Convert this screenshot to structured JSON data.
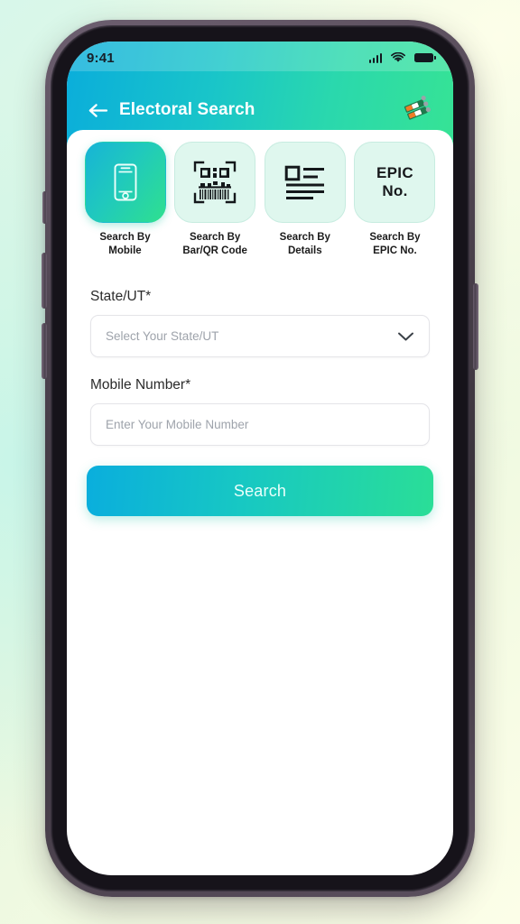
{
  "status_bar": {
    "time": "9:41",
    "signal_icon": "cellular-signal-icon",
    "wifi_icon": "wifi-icon",
    "battery_icon": "battery-full-icon"
  },
  "header": {
    "back_icon": "back-arrow-icon",
    "title": "Electoral Search",
    "logo_icon": "eci-evm-logo-icon"
  },
  "tabs": [
    {
      "icon": "mobile-phone-icon",
      "label_line1": "Search By",
      "label_line2": "Mobile",
      "active": true
    },
    {
      "icon": "barcode-qr-icon",
      "label_line1": "Search By",
      "label_line2": "Bar/QR Code",
      "active": false
    },
    {
      "icon": "details-document-icon",
      "label_line1": "Search By",
      "label_line2": "Details",
      "active": false
    },
    {
      "icon": "epic-no-text-icon",
      "icon_text_line1": "EPIC",
      "icon_text_line2": "No.",
      "label_line1": "Search By",
      "label_line2": "EPIC No.",
      "active": false
    }
  ],
  "form": {
    "state": {
      "label": "State/UT*",
      "placeholder": "Select Your State/UT",
      "value": "",
      "chevron_icon": "chevron-down-icon"
    },
    "mobile": {
      "label": "Mobile Number*",
      "placeholder": "Enter Your Mobile Number",
      "value": ""
    }
  },
  "actions": {
    "search_label": "Search"
  },
  "colors": {
    "gradient_start": "#0AAEDD",
    "gradient_mid": "#17C8C3",
    "gradient_end": "#2ADE97",
    "tile_inactive": "#DFF7EE",
    "placeholder": "#9EA3AB",
    "backdrop_mint": "#D8F7EA",
    "backdrop_cream": "#FCFEE8"
  }
}
